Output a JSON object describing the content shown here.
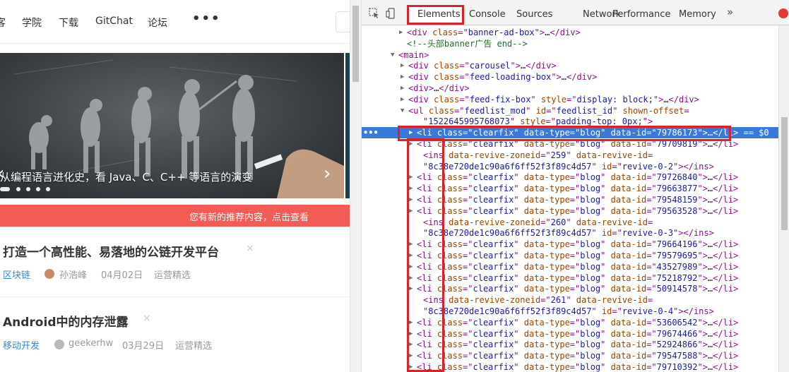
{
  "nav": {
    "items": [
      "客",
      "学院",
      "下载",
      "GitChat",
      "论坛"
    ],
    "more": "•••"
  },
  "banner": {
    "caption": "从编程语言进化史，看 Java、C、C++ 等语言的演变",
    "prev": "‹",
    "next": "›"
  },
  "notice": {
    "text": "您有新的推荐内容，点击查看"
  },
  "feed": [
    {
      "title": "打造一个高性能、易落地的公链开发平台",
      "close": "×",
      "tag": "区块链",
      "author": "孙浩峰",
      "date": "04月02日",
      "source": "运营精选"
    },
    {
      "title": "Android中的内存泄露",
      "close": "×",
      "tag": "移动开发",
      "author": "geekerhw",
      "date": "03月29日",
      "source": "运营精选"
    }
  ],
  "devtools": {
    "tabs": [
      "Elements",
      "Console",
      "Sources",
      "Network",
      "Performance",
      "Memory"
    ],
    "active_tab": "Elements",
    "overflow": "»",
    "selected_marker": "•••",
    "lines": [
      {
        "tri": "▶",
        "html": "<span class='tk-tag'>&lt;div</span> <span class='tk-attr'>class</span><span class='tk-tag'>=\"</span><span class='tk-val'>banner-ad-box</span><span class='tk-tag'>\"&gt;</span><span class='tk-plain'>…</span><span class='tk-tag'>&lt;/div&gt;</span>"
      },
      {
        "tri": "",
        "html": "<span class='tk-comment'>&lt;!--头部banner广告 end--&gt;</span>"
      },
      {
        "tri": "▼",
        "html": "<span class='tk-tag'>&lt;main&gt;</span>"
      },
      {
        "tri": "▶",
        "html": "<span class='tk-tag'>&lt;div</span> <span class='tk-attr'>class</span><span class='tk-tag'>=\"</span><span class='tk-val'>carousel</span><span class='tk-tag'>\"&gt;</span><span class='tk-plain'>…</span><span class='tk-tag'>&lt;/div&gt;</span>"
      },
      {
        "tri": "▶",
        "html": "<span class='tk-tag'>&lt;div</span> <span class='tk-attr'>class</span><span class='tk-tag'>=\"</span><span class='tk-val'>feed-loading-box</span><span class='tk-tag'>\"&gt;</span><span class='tk-plain'>…</span><span class='tk-tag'>&lt;/div&gt;</span>"
      },
      {
        "tri": "▶",
        "html": "<span class='tk-tag'>&lt;div&gt;</span><span class='tk-plain'>…</span><span class='tk-tag'>&lt;/div&gt;</span>"
      },
      {
        "tri": "▶",
        "html": "<span class='tk-tag'>&lt;div</span> <span class='tk-attr'>class</span><span class='tk-tag'>=\"</span><span class='tk-val'>feed-fix-box</span><span class='tk-tag'>\"</span> <span class='tk-attr'>style</span><span class='tk-tag'>=\"</span><span class='tk-val'>display: block;</span><span class='tk-tag'>\"&gt;</span><span class='tk-plain'>…</span><span class='tk-tag'>&lt;/div&gt;</span>"
      },
      {
        "tri": "▼",
        "html": "<span class='tk-tag'>&lt;ul</span> <span class='tk-attr'>class</span><span class='tk-tag'>=\"</span><span class='tk-val'>feedlist_mod</span><span class='tk-tag'>\"</span> <span class='tk-attr'>id</span><span class='tk-tag'>=\"</span><span class='tk-val'>feedlist_id</span><span class='tk-tag'>\"</span> <span class='tk-attr'>shown-offset</span><span class='tk-tag'>=</span>"
      },
      {
        "tri": "",
        "html": "<span class='tk-tag'>\"</span><span class='tk-val'>1522645995768073</span><span class='tk-tag'>\"</span> <span class='tk-attr'>style</span><span class='tk-tag'>=\"</span><span class='tk-val'>padding-top: 0px;</span><span class='tk-tag'>\"&gt;</span>"
      },
      {
        "tri": "▶",
        "selected": true,
        "html": "<span class='tk-tag'>&lt;li</span> <span class='tk-attr'>class</span><span class='tk-tag'>=\"</span><span class='tk-val'>clearfix</span><span class='tk-tag'>\"</span> <span class='tk-attr'>data-type</span><span class='tk-tag'>=\"</span><span class='tk-val'>blog</span><span class='tk-tag'>\"</span> <span class='tk-attr'>data-id</span><span class='tk-tag'>=\"</span><span class='tk-val'>79786173</span><span class='tk-tag'>\"&gt;</span><span class='tk-plain'>…</span><span class='tk-tag'>&lt;/li&gt;</span> <span class='tk-plain'>== $0</span>"
      },
      {
        "tri": "▶",
        "html": "<span class='tk-tag'>&lt;li</span> <span class='tk-attr'>class</span><span class='tk-tag'>=\"</span><span class='tk-val'>clearfix</span><span class='tk-tag'>\"</span> <span class='tk-attr'>data-type</span><span class='tk-tag'>=\"</span><span class='tk-val'>blog</span><span class='tk-tag'>\"</span> <span class='tk-attr'>data-id</span><span class='tk-tag'>=\"</span><span class='tk-val'>79709819</span><span class='tk-tag'>\"&gt;</span><span class='tk-plain'>…</span><span class='tk-tag'>&lt;/li&gt;</span>"
      },
      {
        "tri": "",
        "html": "<span class='tk-tag'>&lt;ins</span> <span class='tk-attr'>data-revive-zoneid</span><span class='tk-tag'>=\"</span><span class='tk-val'>259</span><span class='tk-tag'>\"</span> <span class='tk-attr'>data-revive-id</span><span class='tk-tag'>=</span>"
      },
      {
        "tri": "",
        "html": "<span class='tk-tag'>\"</span><span class='tk-val'>8c38e720de1c90a6f6ff52f3f89c4d57</span><span class='tk-tag'>\"</span> <span class='tk-attr'>id</span><span class='tk-tag'>=\"</span><span class='tk-val'>revive-0-2</span><span class='tk-tag'>\"&gt;&lt;/ins&gt;</span>"
      },
      {
        "tri": "▶",
        "html": "<span class='tk-tag'>&lt;li</span> <span class='tk-attr'>class</span><span class='tk-tag'>=\"</span><span class='tk-val'>clearfix</span><span class='tk-tag'>\"</span> <span class='tk-attr'>data-type</span><span class='tk-tag'>=\"</span><span class='tk-val'>blog</span><span class='tk-tag'>\"</span> <span class='tk-attr'>data-id</span><span class='tk-tag'>=\"</span><span class='tk-val'>79726840</span><span class='tk-tag'>\"&gt;</span><span class='tk-plain'>…</span><span class='tk-tag'>&lt;/li&gt;</span>"
      },
      {
        "tri": "▶",
        "html": "<span class='tk-tag'>&lt;li</span> <span class='tk-attr'>class</span><span class='tk-tag'>=\"</span><span class='tk-val'>clearfix</span><span class='tk-tag'>\"</span> <span class='tk-attr'>data-type</span><span class='tk-tag'>=\"</span><span class='tk-val'>blog</span><span class='tk-tag'>\"</span> <span class='tk-attr'>data-id</span><span class='tk-tag'>=\"</span><span class='tk-val'>79663877</span><span class='tk-tag'>\"&gt;</span><span class='tk-plain'>…</span><span class='tk-tag'>&lt;/li&gt;</span>"
      },
      {
        "tri": "▶",
        "html": "<span class='tk-tag'>&lt;li</span> <span class='tk-attr'>class</span><span class='tk-tag'>=\"</span><span class='tk-val'>clearfix</span><span class='tk-tag'>\"</span> <span class='tk-attr'>data-type</span><span class='tk-tag'>=\"</span><span class='tk-val'>blog</span><span class='tk-tag'>\"</span> <span class='tk-attr'>data-id</span><span class='tk-tag'>=\"</span><span class='tk-val'>79548159</span><span class='tk-tag'>\"&gt;</span><span class='tk-plain'>…</span><span class='tk-tag'>&lt;/li&gt;</span>"
      },
      {
        "tri": "▶",
        "html": "<span class='tk-tag'>&lt;li</span> <span class='tk-attr'>class</span><span class='tk-tag'>=\"</span><span class='tk-val'>clearfix</span><span class='tk-tag'>\"</span> <span class='tk-attr'>data-type</span><span class='tk-tag'>=\"</span><span class='tk-val'>blog</span><span class='tk-tag'>\"</span> <span class='tk-attr'>data-id</span><span class='tk-tag'>=\"</span><span class='tk-val'>79563528</span><span class='tk-tag'>\"&gt;</span><span class='tk-plain'>…</span><span class='tk-tag'>&lt;/li&gt;</span>"
      },
      {
        "tri": "",
        "html": "<span class='tk-tag'>&lt;ins</span> <span class='tk-attr'>data-revive-zoneid</span><span class='tk-tag'>=\"</span><span class='tk-val'>260</span><span class='tk-tag'>\"</span> <span class='tk-attr'>data-revive-id</span><span class='tk-tag'>=</span>"
      },
      {
        "tri": "",
        "html": "<span class='tk-tag'>\"</span><span class='tk-val'>8c38e720de1c90a6f6ff52f3f89c4d57</span><span class='tk-tag'>\"</span> <span class='tk-attr'>id</span><span class='tk-tag'>=\"</span><span class='tk-val'>revive-0-3</span><span class='tk-tag'>\"&gt;&lt;/ins&gt;</span>"
      },
      {
        "tri": "▶",
        "html": "<span class='tk-tag'>&lt;li</span> <span class='tk-attr'>class</span><span class='tk-tag'>=\"</span><span class='tk-val'>clearfix</span><span class='tk-tag'>\"</span> <span class='tk-attr'>data-type</span><span class='tk-tag'>=\"</span><span class='tk-val'>blog</span><span class='tk-tag'>\"</span> <span class='tk-attr'>data-id</span><span class='tk-tag'>=\"</span><span class='tk-val'>79664196</span><span class='tk-tag'>\"&gt;</span><span class='tk-plain'>…</span><span class='tk-tag'>&lt;/li&gt;</span>"
      },
      {
        "tri": "▶",
        "html": "<span class='tk-tag'>&lt;li</span> <span class='tk-attr'>class</span><span class='tk-tag'>=\"</span><span class='tk-val'>clearfix</span><span class='tk-tag'>\"</span> <span class='tk-attr'>data-type</span><span class='tk-tag'>=\"</span><span class='tk-val'>blog</span><span class='tk-tag'>\"</span> <span class='tk-attr'>data-id</span><span class='tk-tag'>=\"</span><span class='tk-val'>79579695</span><span class='tk-tag'>\"&gt;</span><span class='tk-plain'>…</span><span class='tk-tag'>&lt;/li&gt;</span>"
      },
      {
        "tri": "▶",
        "html": "<span class='tk-tag'>&lt;li</span> <span class='tk-attr'>class</span><span class='tk-tag'>=\"</span><span class='tk-val'>clearfix</span><span class='tk-tag'>\"</span> <span class='tk-attr'>data-type</span><span class='tk-tag'>=\"</span><span class='tk-val'>blog</span><span class='tk-tag'>\"</span> <span class='tk-attr'>data-id</span><span class='tk-tag'>=\"</span><span class='tk-val'>43527989</span><span class='tk-tag'>\"&gt;</span><span class='tk-plain'>…</span><span class='tk-tag'>&lt;/li&gt;</span>"
      },
      {
        "tri": "▶",
        "html": "<span class='tk-tag'>&lt;li</span> <span class='tk-attr'>class</span><span class='tk-tag'>=\"</span><span class='tk-val'>clearfix</span><span class='tk-tag'>\"</span> <span class='tk-attr'>data-type</span><span class='tk-tag'>=\"</span><span class='tk-val'>blog</span><span class='tk-tag'>\"</span> <span class='tk-attr'>data-id</span><span class='tk-tag'>=\"</span><span class='tk-val'>75218792</span><span class='tk-tag'>\"&gt;</span><span class='tk-plain'>…</span><span class='tk-tag'>&lt;/li&gt;</span>"
      },
      {
        "tri": "▶",
        "html": "<span class='tk-tag'>&lt;li</span> <span class='tk-attr'>class</span><span class='tk-tag'>=\"</span><span class='tk-val'>clearfix</span><span class='tk-tag'>\"</span> <span class='tk-attr'>data-type</span><span class='tk-tag'>=\"</span><span class='tk-val'>blog</span><span class='tk-tag'>\"</span> <span class='tk-attr'>data-id</span><span class='tk-tag'>=\"</span><span class='tk-val'>50914578</span><span class='tk-tag'>\"&gt;</span><span class='tk-plain'>…</span><span class='tk-tag'>&lt;/li&gt;</span>"
      },
      {
        "tri": "",
        "html": "<span class='tk-tag'>&lt;ins</span> <span class='tk-attr'>data-revive-zoneid</span><span class='tk-tag'>=\"</span><span class='tk-val'>261</span><span class='tk-tag'>\"</span> <span class='tk-attr'>data-revive-id</span><span class='tk-tag'>=</span>"
      },
      {
        "tri": "",
        "html": "<span class='tk-tag'>\"</span><span class='tk-val'>8c38e720de1c90a6f6ff52f3f89c4d57</span><span class='tk-tag'>\"</span> <span class='tk-attr'>id</span><span class='tk-tag'>=\"</span><span class='tk-val'>revive-0-4</span><span class='tk-tag'>\"&gt;&lt;/ins&gt;</span>"
      },
      {
        "tri": "▶",
        "html": "<span class='tk-tag'>&lt;li</span> <span class='tk-attr'>class</span><span class='tk-tag'>=\"</span><span class='tk-val'>clearfix</span><span class='tk-tag'>\"</span> <span class='tk-attr'>data-type</span><span class='tk-tag'>=\"</span><span class='tk-val'>blog</span><span class='tk-tag'>\"</span> <span class='tk-attr'>data-id</span><span class='tk-tag'>=\"</span><span class='tk-val'>53606542</span><span class='tk-tag'>\"&gt;</span><span class='tk-plain'>…</span><span class='tk-tag'>&lt;/li&gt;</span>"
      },
      {
        "tri": "▶",
        "html": "<span class='tk-tag'>&lt;li</span> <span class='tk-attr'>class</span><span class='tk-tag'>=\"</span><span class='tk-val'>clearfix</span><span class='tk-tag'>\"</span> <span class='tk-attr'>data-type</span><span class='tk-tag'>=\"</span><span class='tk-val'>blog</span><span class='tk-tag'>\"</span> <span class='tk-attr'>data-id</span><span class='tk-tag'>=\"</span><span class='tk-val'>79674466</span><span class='tk-tag'>\"&gt;</span><span class='tk-plain'>…</span><span class='tk-tag'>&lt;/li&gt;</span>"
      },
      {
        "tri": "▶",
        "html": "<span class='tk-tag'>&lt;li</span> <span class='tk-attr'>class</span><span class='tk-tag'>=\"</span><span class='tk-val'>clearfix</span><span class='tk-tag'>\"</span> <span class='tk-attr'>data-type</span><span class='tk-tag'>=\"</span><span class='tk-val'>blog</span><span class='tk-tag'>\"</span> <span class='tk-attr'>data-id</span><span class='tk-tag'>=\"</span><span class='tk-val'>52924866</span><span class='tk-tag'>\"&gt;</span><span class='tk-plain'>…</span><span class='tk-tag'>&lt;/li&gt;</span>"
      },
      {
        "tri": "▶",
        "html": "<span class='tk-tag'>&lt;li</span> <span class='tk-attr'>class</span><span class='tk-tag'>=\"</span><span class='tk-val'>clearfix</span><span class='tk-tag'>\"</span> <span class='tk-attr'>data-type</span><span class='tk-tag'>=\"</span><span class='tk-val'>blog</span><span class='tk-tag'>\"</span> <span class='tk-attr'>data-id</span><span class='tk-tag'>=\"</span><span class='tk-val'>79547588</span><span class='tk-tag'>\"&gt;</span><span class='tk-plain'>…</span><span class='tk-tag'>&lt;/li&gt;</span>"
      },
      {
        "tri": "▶",
        "html": "<span class='tk-tag'>&lt;li</span> <span class='tk-attr'>class</span><span class='tk-tag'>=\"</span><span class='tk-val'>clearfix</span><span class='tk-tag'>\"</span> <span class='tk-attr'>data-type</span><span class='tk-tag'>=\"</span><span class='tk-val'>blog</span><span class='tk-tag'>\"</span> <span class='tk-attr'>data-id</span><span class='tk-tag'>=\"</span><span class='tk-val'>79710392</span><span class='tk-tag'>\"&gt;</span><span class='tk-plain'>…</span><span class='tk-tag'>&lt;/li&gt;</span>"
      }
    ]
  },
  "colors": {
    "accent_red": "#d8232a",
    "notice_bg": "#f25c54",
    "selected_row": "#3879d9",
    "tag_blue": "#3b86c4"
  }
}
